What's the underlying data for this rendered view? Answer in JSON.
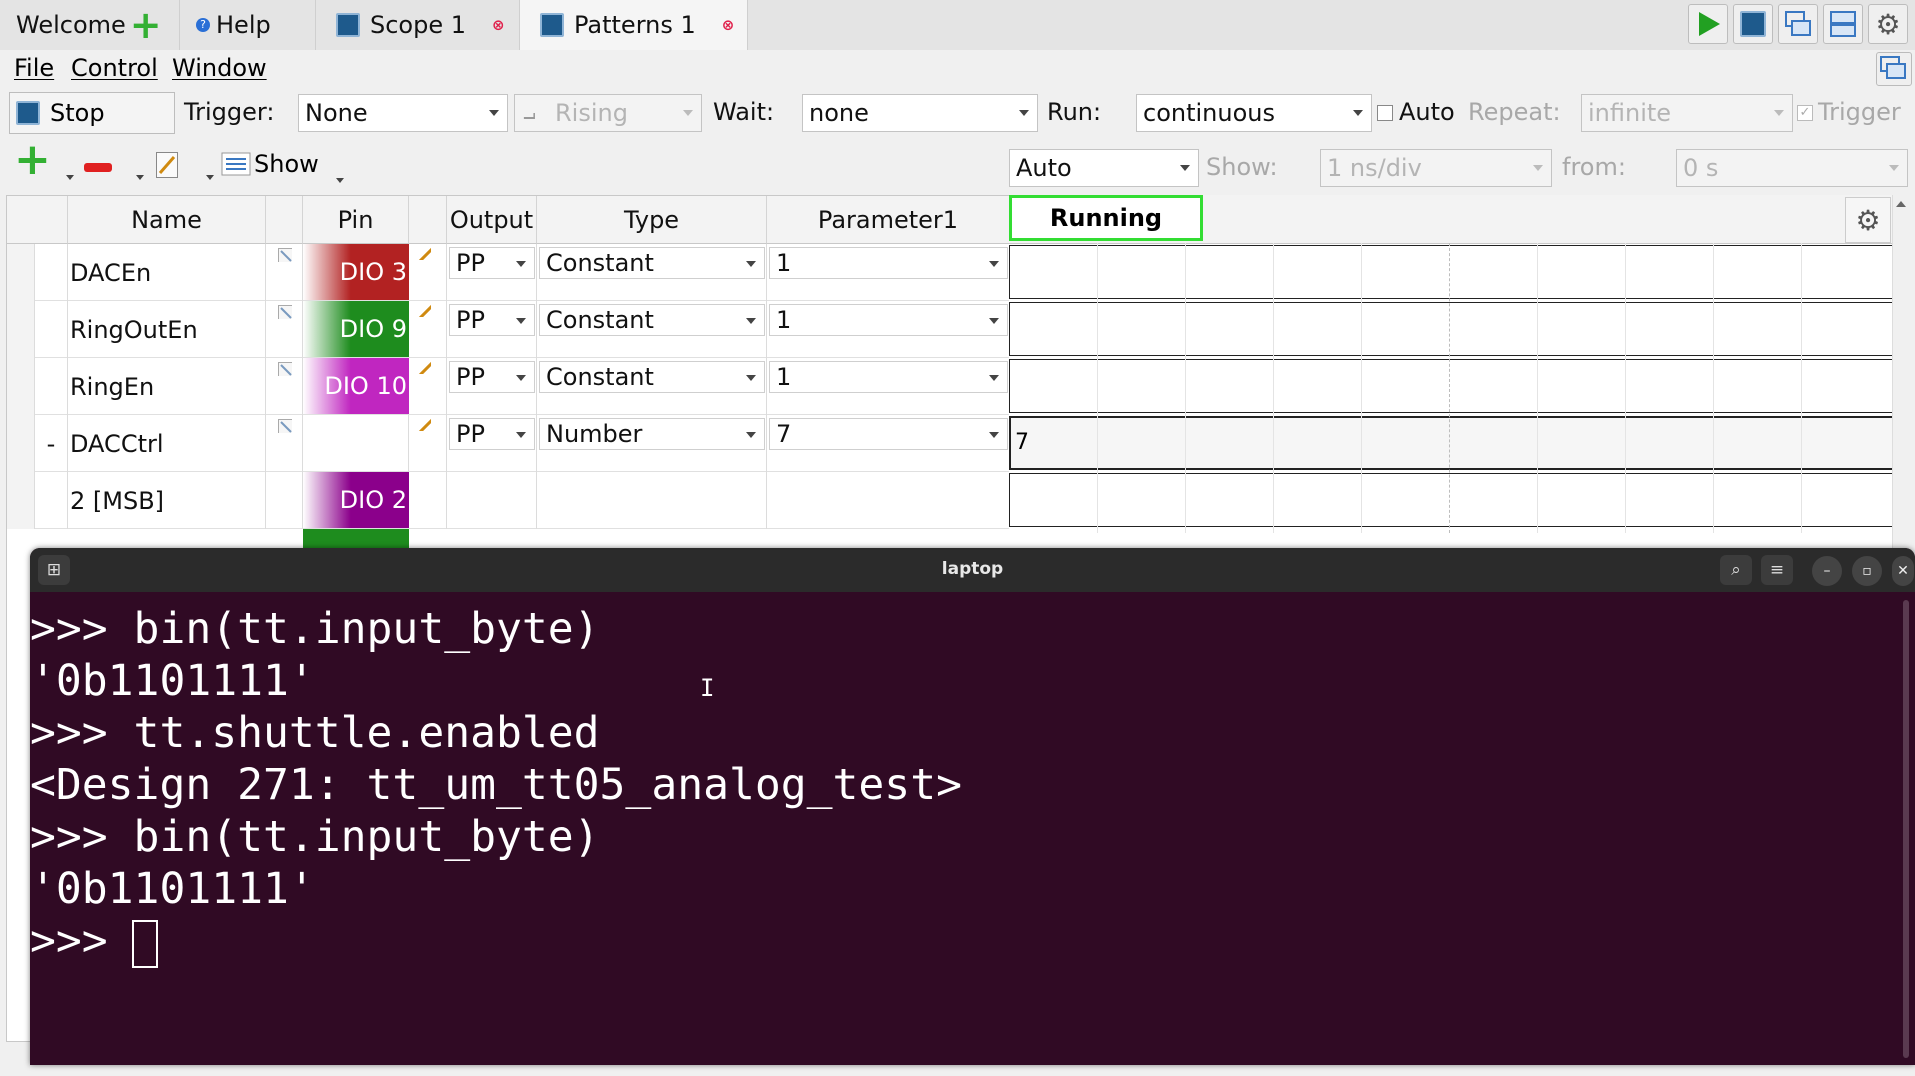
{
  "tabs": {
    "welcome": "Welcome",
    "help": "Help",
    "scope": "Scope 1",
    "patterns": "Patterns 1"
  },
  "menu": {
    "file": "File",
    "control": "Control",
    "window": "Window"
  },
  "control": {
    "stop": "Stop",
    "trigger_label": "Trigger:",
    "trigger_value": "None",
    "edge_value": "Rising",
    "wait_label": "Wait:",
    "wait_value": "none",
    "run_label": "Run:",
    "run_value": "continuous",
    "auto_label": "Auto",
    "repeat_label": "Repeat:",
    "repeat_value": "infinite",
    "trigger_check_label": "Trigger"
  },
  "toolbar": {
    "show_label": "Show",
    "zoom_value": "Auto",
    "show2_label": "Show:",
    "timebase_value": "1 ns/div",
    "from_label": "from:",
    "from_value": "0 s"
  },
  "grid": {
    "headers": {
      "name": "Name",
      "pin": "Pin",
      "output": "Output",
      "type": "Type",
      "param1": "Parameter1"
    },
    "status": "Running",
    "rows": [
      {
        "expander": "",
        "name": "DACEn",
        "pin": "DIO 3",
        "pin_color": "#b22222",
        "output": "PP",
        "type": "Constant",
        "param": "1",
        "wave": ""
      },
      {
        "expander": "",
        "name": "RingOutEn",
        "pin": "DIO 9",
        "pin_color": "#1e8c1e",
        "output": "PP",
        "type": "Constant",
        "param": "1",
        "wave": ""
      },
      {
        "expander": "",
        "name": "RingEn",
        "pin": "DIO 10",
        "pin_color": "#c026c0",
        "output": "PP",
        "type": "Constant",
        "param": "1",
        "wave": ""
      },
      {
        "expander": "-",
        "name": "DACCtrl",
        "pin": "",
        "pin_color": "",
        "output": "PP",
        "type": "Number",
        "param": "7",
        "wave": "7"
      },
      {
        "expander": "",
        "name": "2 [MSB]",
        "pin": "DIO 2",
        "pin_color": "#8b008b",
        "output": "",
        "type": "",
        "param": "",
        "wave": ""
      }
    ]
  },
  "terminal": {
    "title": "laptop",
    "lines": [
      ">>> bin(tt.input_byte)",
      "'0b1101111'",
      ">>> tt.shuttle.enabled",
      "<Design 271: tt_um_tt05_analog_test>",
      ">>> bin(tt.input_byte)",
      "'0b1101111'",
      ">>> "
    ]
  },
  "colors": {
    "terminal_bg": "#300a24",
    "running_border": "#33dd33",
    "accent": "#1e5a8c"
  }
}
